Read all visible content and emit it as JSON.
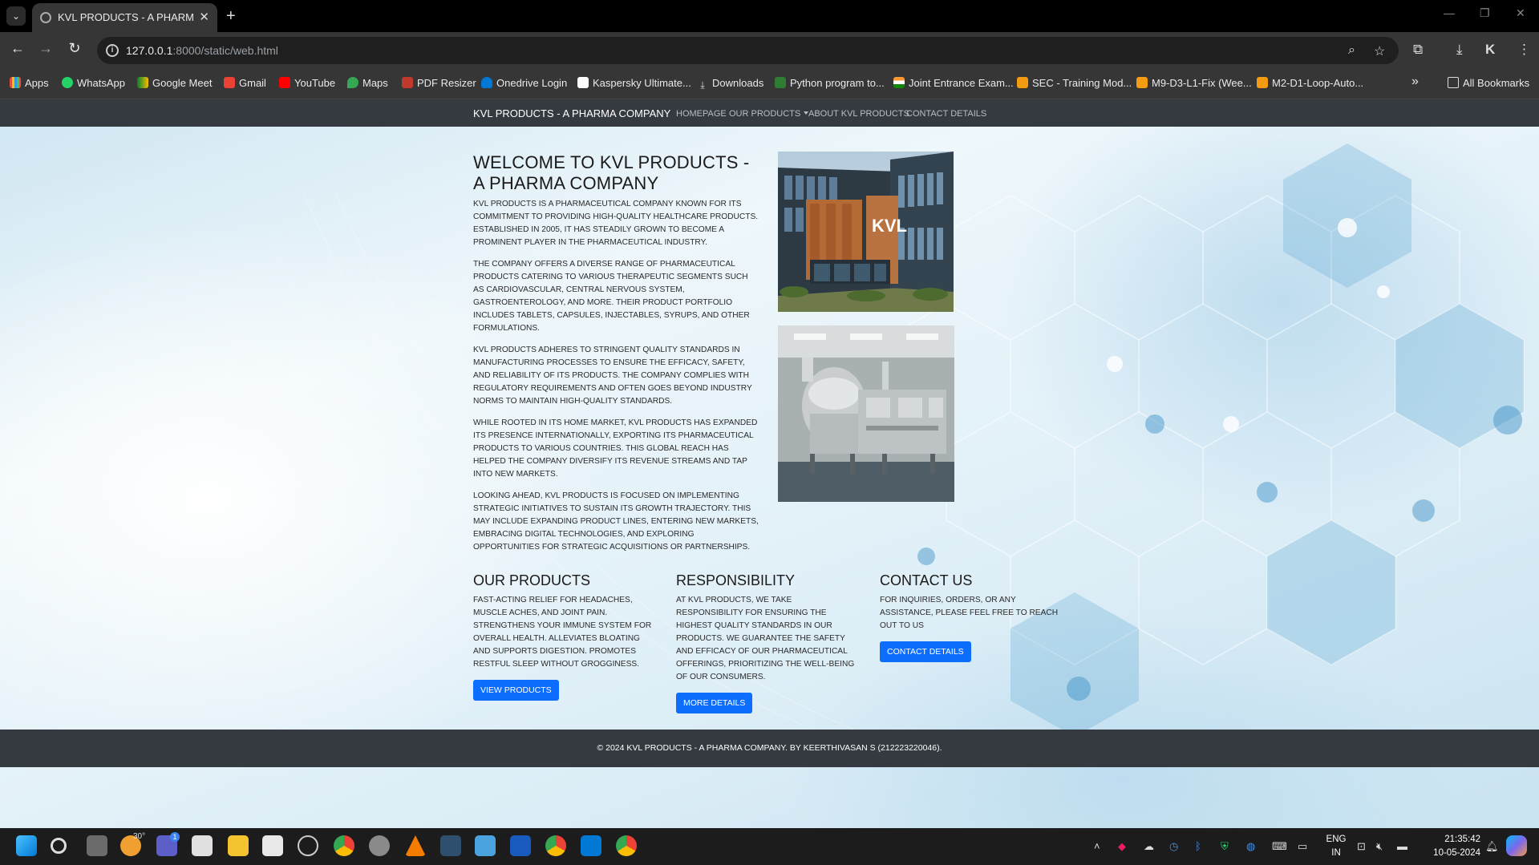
{
  "browser": {
    "tab_title": "KVL PRODUCTS - A PHARMA C",
    "url_host": "127.0.0.1",
    "url_rest": ":8000/static/web.html",
    "bookmarks": [
      "Apps",
      "WhatsApp",
      "Google Meet",
      "Gmail",
      "YouTube",
      "Maps",
      "PDF Resizer",
      "Onedrive Login",
      "Kaspersky Ultimate...",
      "Downloads",
      "Python program to...",
      "Joint Entrance Exam...",
      "SEC - Training Mod...",
      "M9-D3-L1-Fix (Wee...",
      "M2-D1-Loop-Auto..."
    ],
    "all_bookmarks": "All Bookmarks",
    "overflow": "»"
  },
  "navbar": {
    "brand": "KVL PRODUCTS - A PHARMA COMPANY",
    "links": [
      "HOMEPAGE",
      "OUR PRODUCTS",
      "ABOUT KVL PRODUCTS",
      "CONTACT DETAILS"
    ]
  },
  "hero": {
    "title": "WELCOME TO KVL PRODUCTS - A PHARMA COMPANY",
    "paragraphs": [
      "KVL PRODUCTS IS A PHARMACEUTICAL COMPANY KNOWN FOR ITS COMMITMENT TO PROVIDING HIGH-QUALITY HEALTHCARE PRODUCTS. ESTABLISHED IN 2005, IT HAS STEADILY GROWN TO BECOME A PROMINENT PLAYER IN THE PHARMACEUTICAL INDUSTRY.",
      "THE COMPANY OFFERS A DIVERSE RANGE OF PHARMACEUTICAL PRODUCTS CATERING TO VARIOUS THERAPEUTIC SEGMENTS SUCH AS CARDIOVASCULAR, CENTRAL NERVOUS SYSTEM, GASTROENTEROLOGY, AND MORE. THEIR PRODUCT PORTFOLIO INCLUDES TABLETS, CAPSULES, INJECTABLES, SYRUPS, AND OTHER FORMULATIONS.",
      "KVL PRODUCTS ADHERES TO STRINGENT QUALITY STANDARDS IN MANUFACTURING PROCESSES TO ENSURE THE EFFICACY, SAFETY, AND RELIABILITY OF ITS PRODUCTS. THE COMPANY COMPLIES WITH REGULATORY REQUIREMENTS AND OFTEN GOES BEYOND INDUSTRY NORMS TO MAINTAIN HIGH-QUALITY STANDARDS.",
      "WHILE ROOTED IN ITS HOME MARKET, KVL PRODUCTS HAS EXPANDED ITS PRESENCE INTERNATIONALLY, EXPORTING ITS PHARMACEUTICAL PRODUCTS TO VARIOUS COUNTRIES. THIS GLOBAL REACH HAS HELPED THE COMPANY DIVERSIFY ITS REVENUE STREAMS AND TAP INTO NEW MARKETS.",
      "LOOKING AHEAD, KVL PRODUCTS IS FOCUSED ON IMPLEMENTING STRATEGIC INITIATIVES TO SUSTAIN ITS GROWTH TRAJECTORY. THIS MAY INCLUDE EXPANDING PRODUCT LINES, ENTERING NEW MARKETS, EMBRACING DIGITAL TECHNOLOGIES, AND EXPLORING OPPORTUNITIES FOR STRATEGIC ACQUISITIONS OR PARTNERSHIPS."
    ],
    "building_sign": "KVL"
  },
  "cards": [
    {
      "title": "OUR PRODUCTS",
      "text": "FAST-ACTING RELIEF FOR HEADACHES, MUSCLE ACHES, AND JOINT PAIN. STRENGTHENS YOUR IMMUNE SYSTEM FOR OVERALL HEALTH. ALLEVIATES BLOATING AND SUPPORTS DIGESTION. PROMOTES RESTFUL SLEEP WITHOUT GROGGINESS.",
      "button": "VIEW PRODUCTS"
    },
    {
      "title": "RESPONSIBILITY",
      "text": "AT KVL PRODUCTS, WE TAKE RESPONSIBILITY FOR ENSURING THE HIGHEST QUALITY STANDARDS IN OUR PRODUCTS. WE GUARANTEE THE SAFETY AND EFFICACY OF OUR PHARMACEUTICAL OFFERINGS, PRIORITIZING THE WELL-BEING OF OUR CONSUMERS.",
      "button": "MORE DETAILS"
    },
    {
      "title": "CONTACT US",
      "text": "FOR INQUIRIES, ORDERS, OR ANY ASSISTANCE, PLEASE FEEL FREE TO REACH OUT TO US",
      "button": "CONTACT DETAILS"
    }
  ],
  "footer": {
    "text": "© 2024 KVL PRODUCTS - A PHARMA COMPANY. BY KEERTHIVASAN S (212223220046)."
  },
  "taskbar": {
    "weather": "30°",
    "teams_badge": "1",
    "lang_line1": "ENG",
    "lang_line2": "IN",
    "time": "21:35:42",
    "date": "10-05-2024"
  },
  "colors": {
    "navbar_bg": "#343a40",
    "button_primary": "#0d6efd",
    "chrome_bg": "#363636"
  }
}
